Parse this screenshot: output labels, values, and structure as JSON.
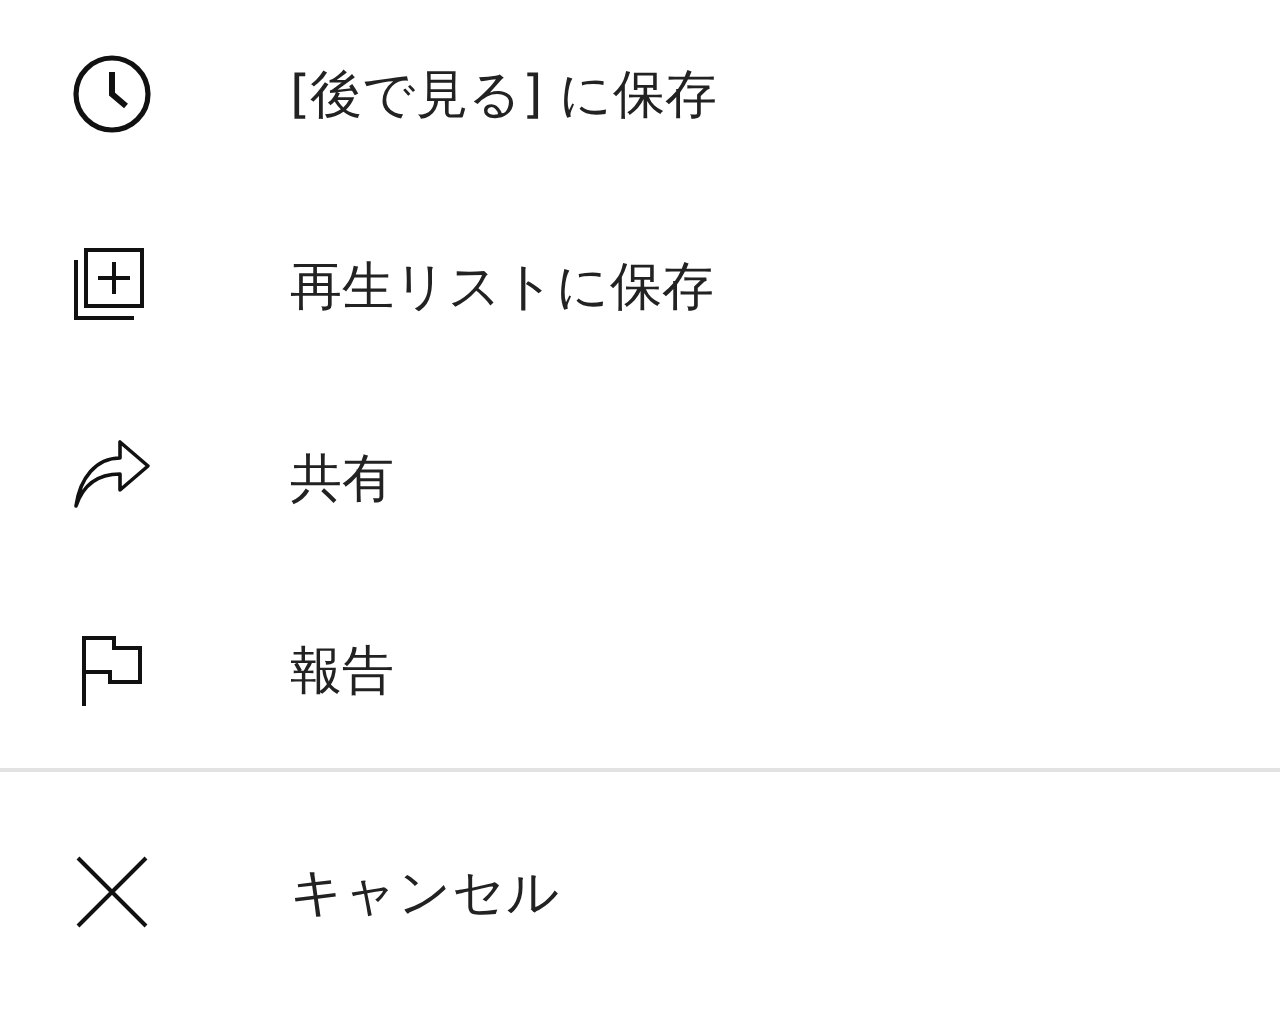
{
  "menu_items": [
    {
      "kind": "clock",
      "label": "[後で見る] に保存"
    },
    {
      "kind": "playlist",
      "label": "再生リストに保存"
    },
    {
      "kind": "share",
      "label": "共有"
    },
    {
      "kind": "flag",
      "label": "報告"
    }
  ],
  "cancel": {
    "kind": "close",
    "label": "キャンセル"
  }
}
